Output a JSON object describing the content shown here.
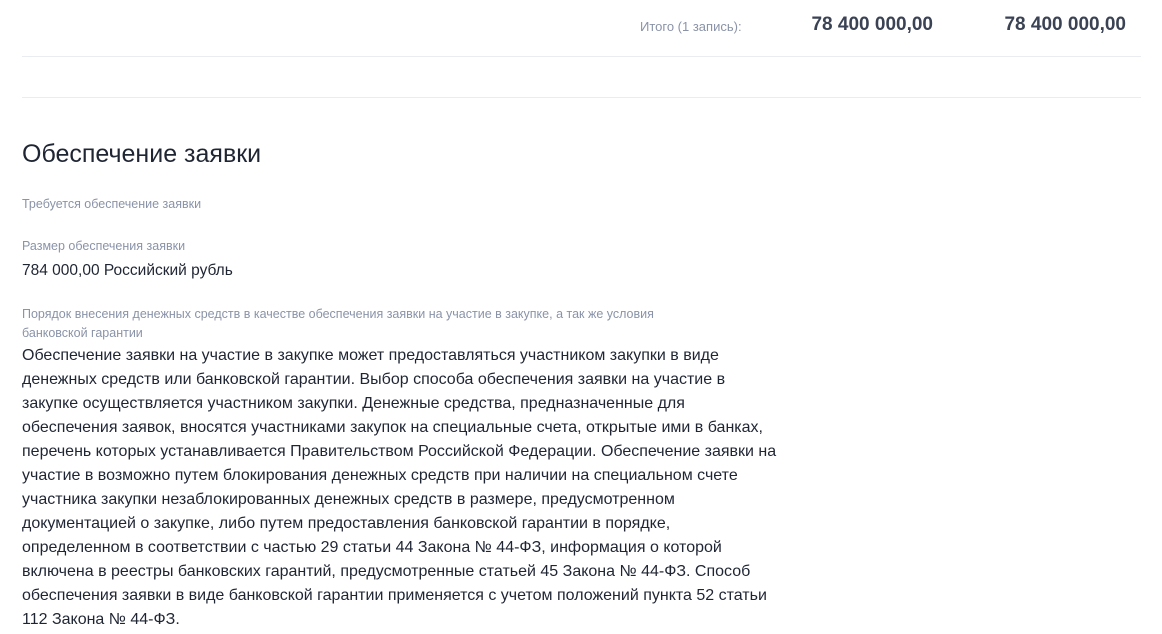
{
  "totals": {
    "label": "Итого (1 запись):",
    "value_1": "78 400 000,00",
    "value_2": "78 400 000,00"
  },
  "section": {
    "title": "Обеспечение заявки",
    "requirement_label": "Требуется обеспечение заявки",
    "amount_label": "Размер обеспечения заявки",
    "amount_value": "784 000,00 Российский рубль",
    "procedure_label": "Порядок внесения денежных средств в качестве обеспечения заявки на участие в закупке, а так же условия банковской гарантии",
    "procedure_text": "Обеспечение заявки на участие в закупке может предоставляться участником закупки в виде денежных средств или банковской гарантии. Выбор способа обеспечения заявки на участие в закупке осуществляется участником закупки. Денежные средства, предназначенные для обеспечения заявок, вносятся участниками закупок на специальные счета, открытые ими в банках, перечень которых устанавливается Правительством Российской Федерации. Обеспечение заявки на участие в возможно путем блокирования денежных средств при наличии на специальном счете участника закупки незаблокированных денежных средств в размере, предусмотренном документацией о закупке, либо путем предоставления банковской гарантии в порядке, определенном в соответствии с частью 29 статьи 44 Закона № 44-ФЗ, информация о которой включена в реестры банковских гарантий, предусмотренные статьей 45 Закона № 44-ФЗ. Способ обеспечения заявки в виде банковской гарантии применяется с учетом положений пункта 52 статьи 112 Закона № 44-ФЗ."
  }
}
